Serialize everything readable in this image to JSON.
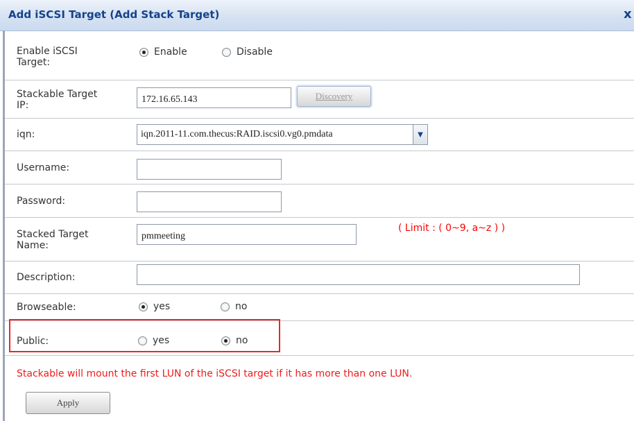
{
  "dialog": {
    "title": "Add iSCSI Target (Add Stack Target)",
    "close_label": "x"
  },
  "form": {
    "enable": {
      "label_line1": "Enable iSCSI",
      "label_line2": "Target:",
      "options": [
        "Enable",
        "Disable"
      ],
      "selected": "Enable"
    },
    "target_ip": {
      "label_line1": "Stackable Target",
      "label_line2": "IP:",
      "value": "172.16.65.143",
      "discovery_label": "Discovery"
    },
    "iqn": {
      "label": "iqn:",
      "selected": "iqn.2011-11.com.thecus:RAID.iscsi0.vg0.pmdata",
      "arrow_icon": "chevron-down-icon"
    },
    "username": {
      "label": "Username:",
      "value": ""
    },
    "password": {
      "label": "Password:",
      "value": ""
    },
    "stacked_name": {
      "label_line1": "Stacked Target",
      "label_line2": "Name:",
      "value": "pmmeeting",
      "limit_hint": "( Limit : ( 0~9, a~z ) )"
    },
    "description": {
      "label": "Description:",
      "value": ""
    },
    "browseable": {
      "label": "Browseable:",
      "options": [
        "yes",
        "no"
      ],
      "selected": "yes"
    },
    "public": {
      "label": "Public:",
      "options": [
        "yes",
        "no"
      ],
      "selected": "no"
    },
    "note": "Stackable will mount the first LUN of the iSCSI target if it has more than one LUN.",
    "apply_label": "Apply"
  },
  "colors": {
    "title": "#15428b",
    "warning": "#ee1c1c",
    "highlight_border": "#e8262d"
  }
}
